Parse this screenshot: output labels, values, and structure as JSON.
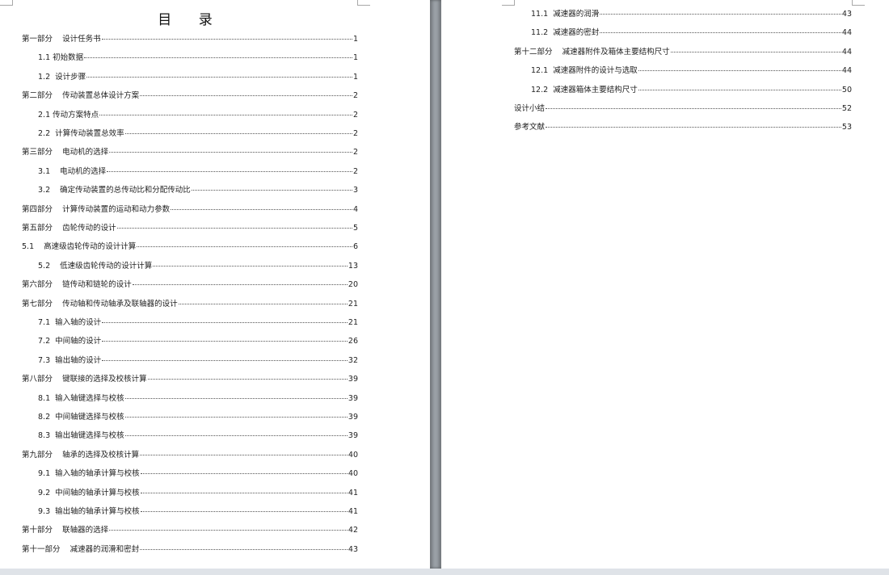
{
  "left_page": {
    "title": "目 录",
    "entries": [
      {
        "text": "第一部分    设计任务书",
        "page": "1"
      },
      {
        "text": "1.1 初始数据",
        "page": "1"
      },
      {
        "text": "1.2  设计步骤",
        "page": "1"
      },
      {
        "text": "第二部分    传动装置总体设计方案",
        "page": "2"
      },
      {
        "text": "2.1 传动方案特点",
        "page": "2"
      },
      {
        "text": "2.2  计算传动装置总效率",
        "page": "2"
      },
      {
        "text": "第三部分    电动机的选择",
        "page": "2"
      },
      {
        "text": "3.1    电动机的选择",
        "page": "2"
      },
      {
        "text": "3.2    确定传动装置的总传动比和分配传动比",
        "page": "3"
      },
      {
        "text": "第四部分    计算传动装置的运动和动力参数",
        "page": "4"
      },
      {
        "text": "第五部分    齿轮传动的设计",
        "page": "5"
      },
      {
        "text": "5.1    高速级齿轮传动的设计计算",
        "page": "6"
      },
      {
        "text": "5.2    低速级齿轮传动的设计计算",
        "page": "13"
      },
      {
        "text": "第六部分    链传动和链轮的设计",
        "page": "20"
      },
      {
        "text": "第七部分    传动轴和传动轴承及联轴器的设计",
        "page": "21"
      },
      {
        "text": "7.1  输入轴的设计",
        "page": "21"
      },
      {
        "text": "7.2  中间轴的设计",
        "page": "26"
      },
      {
        "text": "7.3  输出轴的设计",
        "page": "32"
      },
      {
        "text": "第八部分    键联接的选择及校核计算",
        "page": "39"
      },
      {
        "text": "8.1  输入轴键选择与校核",
        "page": "39"
      },
      {
        "text": "8.2  中间轴键选择与校核",
        "page": "39"
      },
      {
        "text": "8.3  输出轴键选择与校核",
        "page": "39"
      },
      {
        "text": "第九部分    轴承的选择及校核计算",
        "page": "40"
      },
      {
        "text": "9.1  输入轴的轴承计算与校核",
        "page": "40"
      },
      {
        "text": "9.2  中间轴的轴承计算与校核",
        "page": "41"
      },
      {
        "text": "9.3  输出轴的轴承计算与校核",
        "page": "41"
      },
      {
        "text": "第十部分    联轴器的选择",
        "page": "42"
      },
      {
        "text": "第十一部分    减速器的润滑和密封",
        "page": "43"
      }
    ]
  },
  "right_page": {
    "entries": [
      {
        "text": "11.1  减速器的润滑",
        "page": "43"
      },
      {
        "text": "11.2  减速器的密封",
        "page": "44"
      },
      {
        "text": "第十二部分    减速器附件及箱体主要结构尺寸",
        "page": "44"
      },
      {
        "text": "12.1  减速器附件的设计与选取",
        "page": "44"
      },
      {
        "text": "12.2  减速器箱体主要结构尺寸",
        "page": "50"
      },
      {
        "text": "设计小结",
        "page": "52"
      },
      {
        "text": "参考文献",
        "page": "53"
      }
    ]
  }
}
